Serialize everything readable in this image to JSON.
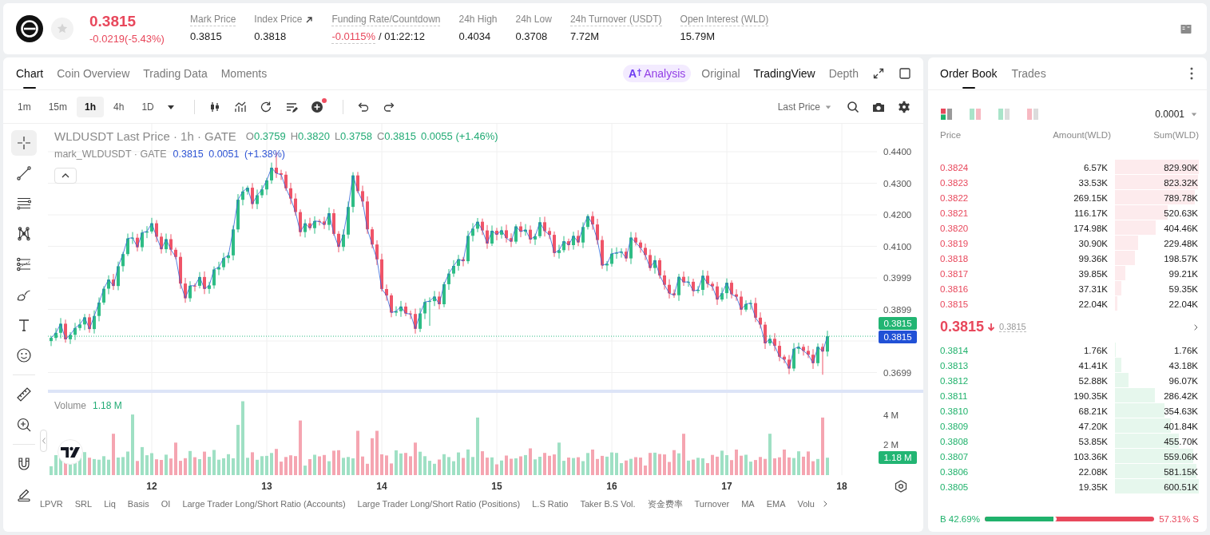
{
  "header": {
    "price": "0.3815",
    "falling": true,
    "change": "-0.0219(-5.43%)",
    "stats": [
      {
        "label": "Mark Price",
        "value": "0.3815",
        "kind": "plain",
        "tooltip": true
      },
      {
        "label": "Index Price",
        "value": "0.3818",
        "kind": "link",
        "tooltip": false
      },
      {
        "label": "Funding Rate/Countdown",
        "value": "-0.0115%",
        "extra": "/ 01:22:12",
        "kind": "funding",
        "tooltip": true
      },
      {
        "label": "24h High",
        "value": "0.4034",
        "kind": "plain",
        "tooltip": false
      },
      {
        "label": "24h Low",
        "value": "0.3708",
        "kind": "plain",
        "tooltip": false
      },
      {
        "label": "24h Turnover (USDT)",
        "value": "7.72M",
        "kind": "plain",
        "tooltip": true
      },
      {
        "label": "Open Interest (WLD)",
        "value": "15.79M",
        "kind": "plain",
        "tooltip": true
      }
    ]
  },
  "chart_panel": {
    "tabs": [
      {
        "label": "Chart",
        "selected": true
      },
      {
        "label": "Coin Overview",
        "selected": false
      },
      {
        "label": "Trading Data",
        "selected": false
      },
      {
        "label": "Moments",
        "selected": false
      }
    ],
    "analysis": {
      "glyph": "A",
      "label": "Analysis"
    },
    "views": [
      {
        "label": "Original",
        "selected": false
      },
      {
        "label": "TradingView",
        "selected": true
      },
      {
        "label": "Depth",
        "selected": false
      }
    ],
    "toolbar": {
      "intervals": [
        {
          "label": "1m",
          "selected": false
        },
        {
          "label": "15m",
          "selected": false
        },
        {
          "label": "1h",
          "selected": true
        },
        {
          "label": "4h",
          "selected": false
        },
        {
          "label": "1D",
          "selected": false
        }
      ],
      "indicator_badge": true,
      "price_source": "Last Price"
    },
    "drawing_tools": [
      [
        {
          "kind": "crosshair",
          "selected": true
        },
        {
          "kind": "trend-line",
          "selected": false
        },
        {
          "kind": "horizontal-lines",
          "selected": false
        },
        {
          "kind": "pattern",
          "selected": false
        },
        {
          "kind": "projection",
          "selected": false
        },
        {
          "kind": "brush",
          "selected": false
        },
        {
          "kind": "text",
          "selected": false
        },
        {
          "kind": "emoji",
          "selected": false
        }
      ],
      [
        {
          "kind": "measure",
          "selected": false
        },
        {
          "kind": "zoom",
          "selected": false
        }
      ],
      [
        {
          "kind": "magnet",
          "selected": false
        },
        {
          "kind": "pencil",
          "selected": false
        }
      ]
    ],
    "legend": {
      "symbol": "WLDUSDT Last Price · 1h · GATE",
      "ohlc": [
        {
          "key": "O",
          "value": "0.3759"
        },
        {
          "key": "H",
          "value": "0.3820"
        },
        {
          "key": "L",
          "value": "0.3758"
        },
        {
          "key": "C",
          "value": "0.3815"
        }
      ],
      "change": "0.0055 (+1.46%)",
      "mark_symbol": "mark_WLDUSDT · GATE",
      "mark_values": "0.3815 0.0051 (+1.38%)"
    },
    "price_scale": [
      "0.4400",
      "0.4300",
      "0.4200",
      "0.4100",
      "0.3999",
      "0.3899",
      "0.3699"
    ],
    "price_tags": {
      "last": "0.3815",
      "mark": "0.3815"
    },
    "volume": {
      "label": "Volume",
      "value": "1.18 M",
      "scale": [
        "4 M",
        "2 M"
      ],
      "tag": "1.18 M"
    },
    "time_scale": [
      "12",
      "13",
      "14",
      "15",
      "16",
      "17",
      "18"
    ],
    "indicators": [
      "LPVR",
      "SRL",
      "Liq",
      "Basis",
      "OI",
      "Large Trader Long/Short Ratio (Accounts)",
      "Large Trader Long/Short Ratio (Positions)",
      "L.S Ratio",
      "Taker B.S Vol.",
      "资金费率",
      "Turnover",
      "MA",
      "EMA",
      "Volu"
    ]
  },
  "order_book": {
    "tabs": [
      {
        "label": "Order Book",
        "selected": true
      },
      {
        "label": "Trades",
        "selected": false
      }
    ],
    "layouts": [
      {
        "kind": "both",
        "selected": true
      },
      {
        "kind": "side-by-side",
        "selected": false
      },
      {
        "kind": "bids",
        "selected": false
      },
      {
        "kind": "asks",
        "selected": false
      }
    ],
    "precision": "0.0001",
    "columns": [
      "Price",
      "Amount(WLD)",
      "Sum(WLD)"
    ],
    "asks": [
      {
        "price": "0.3824",
        "amount": "6.57K",
        "sum": "829.90K",
        "level": 1
      },
      {
        "price": "0.3823",
        "amount": "33.53K",
        "sum": "823.32K",
        "level": 0.992
      },
      {
        "price": "0.3822",
        "amount": "269.15K",
        "sum": "789.78K",
        "level": 0.952
      },
      {
        "price": "0.3821",
        "amount": "116.17K",
        "sum": "520.63K",
        "level": 0.627
      },
      {
        "price": "0.3820",
        "amount": "174.98K",
        "sum": "404.46K",
        "level": 0.487
      },
      {
        "price": "0.3819",
        "amount": "30.90K",
        "sum": "229.48K",
        "level": 0.277
      },
      {
        "price": "0.3818",
        "amount": "99.36K",
        "sum": "198.57K",
        "level": 0.239
      },
      {
        "price": "0.3817",
        "amount": "39.85K",
        "sum": "99.21K",
        "level": 0.12
      },
      {
        "price": "0.3816",
        "amount": "37.31K",
        "sum": "59.35K",
        "level": 0.072
      },
      {
        "price": "0.3815",
        "amount": "22.04K",
        "sum": "22.04K",
        "level": 0.027
      }
    ],
    "last_price": "0.3815",
    "falling": true,
    "mark_price": "0.3815",
    "bids": [
      {
        "price": "0.3814",
        "amount": "1.76K",
        "sum": "1.76K",
        "level": 0.003
      },
      {
        "price": "0.3813",
        "amount": "41.41K",
        "sum": "43.18K",
        "level": 0.072
      },
      {
        "price": "0.3812",
        "amount": "52.88K",
        "sum": "96.07K",
        "level": 0.16
      },
      {
        "price": "0.3811",
        "amount": "190.35K",
        "sum": "286.42K",
        "level": 0.477
      },
      {
        "price": "0.3810",
        "amount": "68.21K",
        "sum": "354.63K",
        "level": 0.591
      },
      {
        "price": "0.3809",
        "amount": "47.20K",
        "sum": "401.84K",
        "level": 0.669
      },
      {
        "price": "0.3808",
        "amount": "53.85K",
        "sum": "455.70K",
        "level": 0.759
      },
      {
        "price": "0.3807",
        "amount": "103.36K",
        "sum": "559.06K",
        "level": 0.931
      },
      {
        "price": "0.3806",
        "amount": "22.08K",
        "sum": "581.15K",
        "level": 0.968
      },
      {
        "price": "0.3805",
        "amount": "19.35K",
        "sum": "600.51K",
        "level": 1
      }
    ],
    "ratio": {
      "buy": "B 42.69%",
      "sell": "57.31% S",
      "level": 0.4269
    }
  }
}
